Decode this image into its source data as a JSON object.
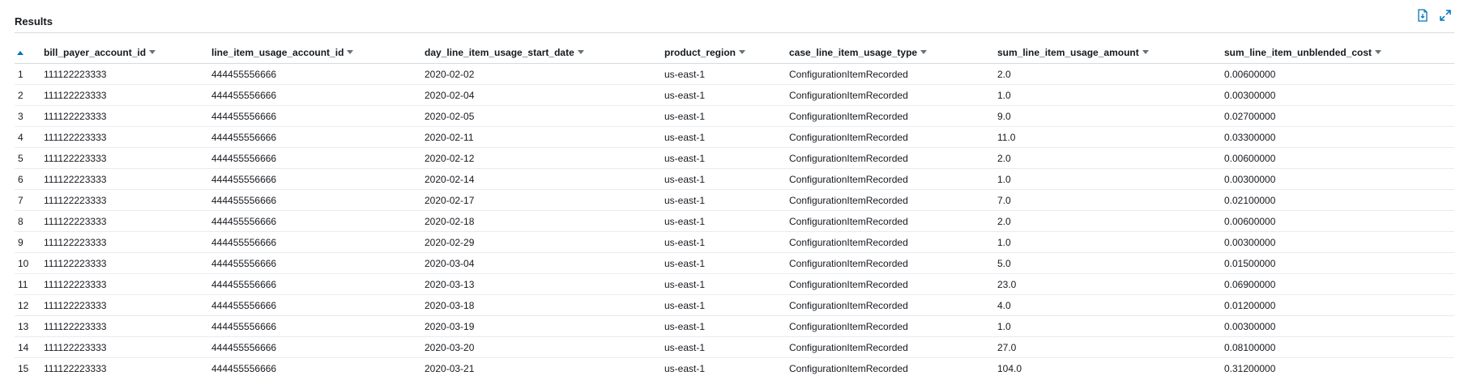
{
  "panel": {
    "title": "Results",
    "actions": [
      {
        "name": "download-results-icon"
      },
      {
        "name": "expand-icon"
      }
    ]
  },
  "table": {
    "columns": [
      {
        "key": "row",
        "label": ""
      },
      {
        "key": "bill_payer_account_id",
        "label": "bill_payer_account_id"
      },
      {
        "key": "line_item_usage_account_id",
        "label": "line_item_usage_account_id"
      },
      {
        "key": "day_line_item_usage_start_date",
        "label": "day_line_item_usage_start_date"
      },
      {
        "key": "product_region",
        "label": "product_region"
      },
      {
        "key": "case_line_item_usage_type",
        "label": "case_line_item_usage_type"
      },
      {
        "key": "sum_line_item_usage_amount",
        "label": "sum_line_item_usage_amount"
      },
      {
        "key": "sum_line_item_unblended_cost",
        "label": "sum_line_item_unblended_cost"
      }
    ],
    "rows": [
      [
        "1",
        "111122223333",
        "444455556666",
        "2020-02-02",
        "us-east-1",
        "ConfigurationItemRecorded",
        "2.0",
        "0.00600000"
      ],
      [
        "2",
        "111122223333",
        "444455556666",
        "2020-02-04",
        "us-east-1",
        "ConfigurationItemRecorded",
        "1.0",
        "0.00300000"
      ],
      [
        "3",
        "111122223333",
        "444455556666",
        "2020-02-05",
        "us-east-1",
        "ConfigurationItemRecorded",
        "9.0",
        "0.02700000"
      ],
      [
        "4",
        "111122223333",
        "444455556666",
        "2020-02-11",
        "us-east-1",
        "ConfigurationItemRecorded",
        "11.0",
        "0.03300000"
      ],
      [
        "5",
        "111122223333",
        "444455556666",
        "2020-02-12",
        "us-east-1",
        "ConfigurationItemRecorded",
        "2.0",
        "0.00600000"
      ],
      [
        "6",
        "111122223333",
        "444455556666",
        "2020-02-14",
        "us-east-1",
        "ConfigurationItemRecorded",
        "1.0",
        "0.00300000"
      ],
      [
        "7",
        "111122223333",
        "444455556666",
        "2020-02-17",
        "us-east-1",
        "ConfigurationItemRecorded",
        "7.0",
        "0.02100000"
      ],
      [
        "8",
        "111122223333",
        "444455556666",
        "2020-02-18",
        "us-east-1",
        "ConfigurationItemRecorded",
        "2.0",
        "0.00600000"
      ],
      [
        "9",
        "111122223333",
        "444455556666",
        "2020-02-29",
        "us-east-1",
        "ConfigurationItemRecorded",
        "1.0",
        "0.00300000"
      ],
      [
        "10",
        "111122223333",
        "444455556666",
        "2020-03-04",
        "us-east-1",
        "ConfigurationItemRecorded",
        "5.0",
        "0.01500000"
      ],
      [
        "11",
        "111122223333",
        "444455556666",
        "2020-03-13",
        "us-east-1",
        "ConfigurationItemRecorded",
        "23.0",
        "0.06900000"
      ],
      [
        "12",
        "111122223333",
        "444455556666",
        "2020-03-18",
        "us-east-1",
        "ConfigurationItemRecorded",
        "4.0",
        "0.01200000"
      ],
      [
        "13",
        "111122223333",
        "444455556666",
        "2020-03-19",
        "us-east-1",
        "ConfigurationItemRecorded",
        "1.0",
        "0.00300000"
      ],
      [
        "14",
        "111122223333",
        "444455556666",
        "2020-03-20",
        "us-east-1",
        "ConfigurationItemRecorded",
        "27.0",
        "0.08100000"
      ],
      [
        "15",
        "111122223333",
        "444455556666",
        "2020-03-21",
        "us-east-1",
        "ConfigurationItemRecorded",
        "104.0",
        "0.31200000"
      ]
    ]
  },
  "colors": {
    "accent": "#0073bb",
    "caret": "#687078",
    "text": "#16191f",
    "divider": "#d5dbdb"
  }
}
